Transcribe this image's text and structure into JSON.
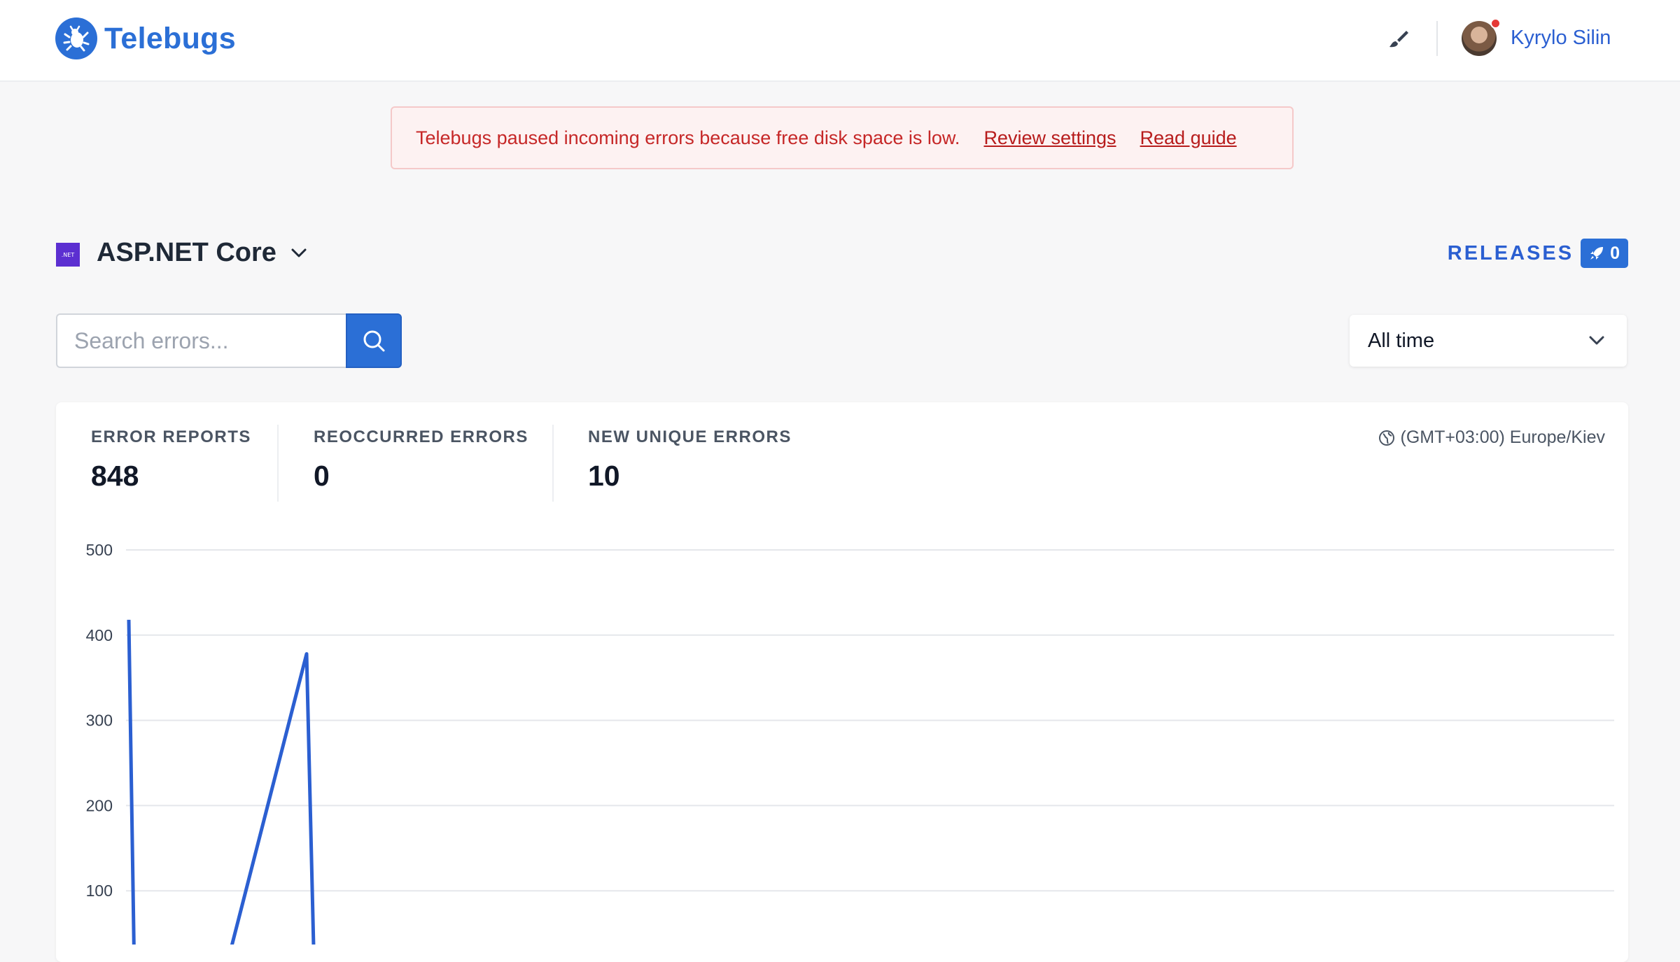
{
  "app": {
    "name": "Telebugs"
  },
  "header": {
    "user_name": "Kyrylo Silin"
  },
  "alert": {
    "message": "Telebugs paused incoming errors because free disk space is low.",
    "link_review": "Review settings",
    "link_guide": "Read guide"
  },
  "project": {
    "name": "ASP.NET Core",
    "icon_text": ".NET"
  },
  "releases": {
    "label": "RELEASES",
    "count": "0"
  },
  "search": {
    "placeholder": "Search errors..."
  },
  "time_filter": {
    "selected": "All time"
  },
  "stats": [
    {
      "label": "ERROR REPORTS",
      "value": "848"
    },
    {
      "label": "REOCCURRED ERRORS",
      "value": "0"
    },
    {
      "label": "NEW UNIQUE ERRORS",
      "value": "10"
    }
  ],
  "timezone": "(GMT+03:00) Europe/Kiev",
  "colors": {
    "brand": "#2b6fd6",
    "alert_text": "#c62828",
    "line": "#2b5fd1"
  },
  "chart_data": {
    "type": "line",
    "y_ticks": [
      100,
      200,
      300,
      400,
      500
    ],
    "ylim": [
      0,
      500
    ],
    "x": [
      0,
      1,
      2,
      3,
      4,
      5,
      6,
      7,
      8,
      9,
      10
    ],
    "values": [
      418,
      0,
      0,
      0,
      0,
      378,
      0,
      0,
      0,
      0,
      10
    ],
    "grid": true
  }
}
